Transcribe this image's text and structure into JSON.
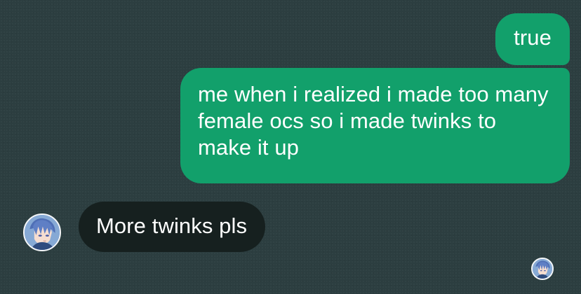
{
  "messages": [
    {
      "direction": "outgoing",
      "text": "true"
    },
    {
      "direction": "outgoing",
      "text": "me when i realized i made too many female ocs so i made twinks to make it up"
    },
    {
      "direction": "incoming",
      "text": "More twinks pls"
    }
  ],
  "avatars": {
    "sender": "user-avatar-icon",
    "read_receipt": "read-receipt-avatar-icon"
  },
  "colors": {
    "background": "#2c3e40",
    "outgoing_bubble": "#12a06b",
    "incoming_bubble": "#16201f",
    "text": "#ffffff"
  }
}
